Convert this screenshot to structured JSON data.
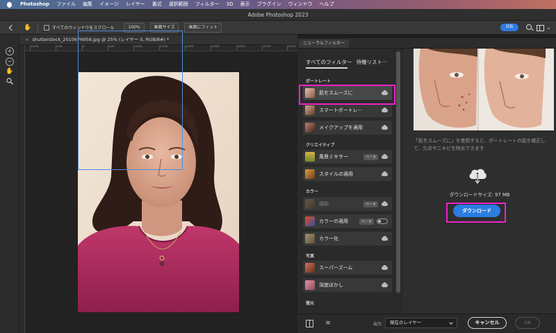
{
  "menubar": {
    "app": "Photoshop",
    "items": [
      "ファイル",
      "編集",
      "イメージ",
      "レイヤー",
      "書式",
      "選択範囲",
      "フィルター",
      "3D",
      "表示",
      "プラグイン",
      "ウィンドウ",
      "ヘルプ"
    ]
  },
  "window": {
    "title": "Adobe Photoshop 2023"
  },
  "options": {
    "scroll_all_label": "すべてのウィンドウをスクロール",
    "zoom_100": "100%",
    "fit_screen_size": "画面サイズ",
    "fit_screen": "画面にフィット",
    "share_label": "共有"
  },
  "document": {
    "tab_title": "shutterstock_2010676958.jpg @ 25% (レイヤー 0, RGB/8#) *",
    "ruler_ticks": [
      "1000",
      "500",
      "0",
      "500",
      "1000",
      "1500",
      "2000",
      "2500",
      "3000",
      "3500",
      "4000"
    ]
  },
  "neural": {
    "panel_tab": "ニューラルフィルター",
    "filter_tabs": "すべてのフィルター",
    "waitlist_tab": "待機リスト···",
    "categories": {
      "portrait": "ポートレート",
      "creative": "クリエイティブ",
      "color": "カラー",
      "photo": "写真",
      "restore": "復元"
    },
    "beta_label": "ベータ",
    "filters": {
      "skin_smoothing": "肌をスムーズに",
      "smart_portrait": "スマートポートレ···",
      "makeup_transfer": "メイクアップを適用",
      "landscape_mixer": "風景ミキサー",
      "style_transfer": "スタイルの適用",
      "harmonization": "調和",
      "color_transfer": "カラーの適用",
      "colorize": "カラー化",
      "super_zoom": "スーパーズーム",
      "depth_blur": "深度ぼかし"
    },
    "description": "「肌をスムーズに」を使用すると、ポートレートの肌を補正して、欠点やニキビを除去できます",
    "download_size": "ダウンロードサイズ: 97 MB",
    "download_button": "ダウンロード",
    "output_label": "出力",
    "output_value": "現在のレイヤー",
    "cancel_button": "キャンセル",
    "ok_button": "OK"
  },
  "colors": {
    "accent": "#2a7de1",
    "highlight": "#ee22c8",
    "face_box": "#4a8fe0"
  }
}
